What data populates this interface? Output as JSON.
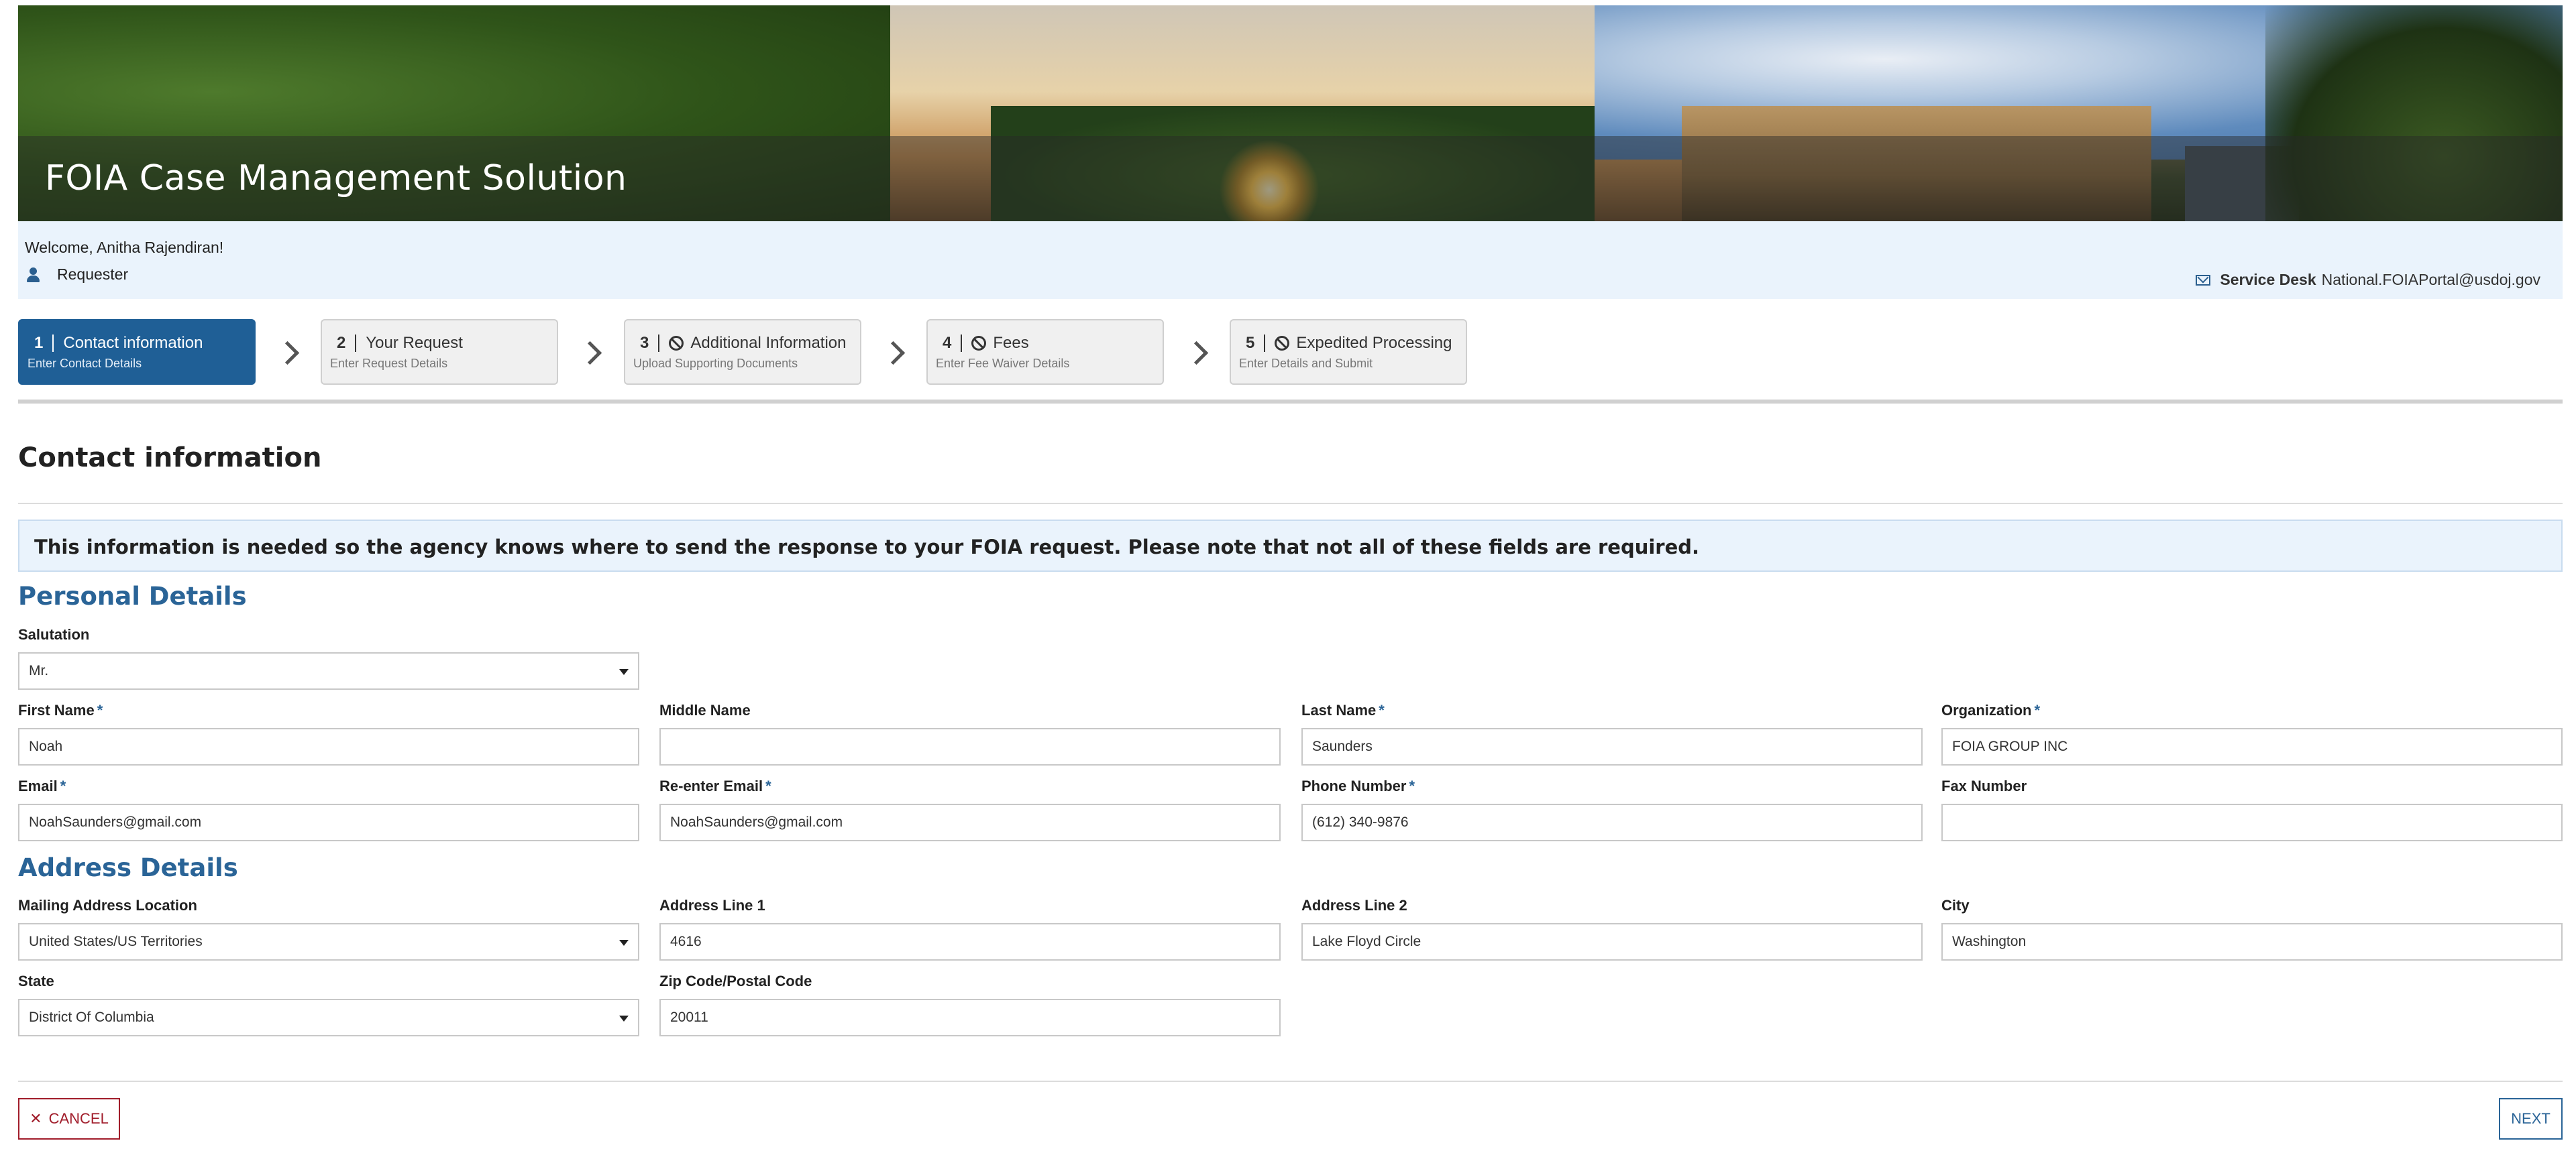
{
  "header": {
    "title": "FOIA Case Management Solution"
  },
  "welcome": {
    "greeting": "Welcome, Anitha Rajendiran!",
    "role": "Requester",
    "service_desk_label": "Service Desk",
    "service_desk_email": "National.FOIAPortal@usdoj.gov"
  },
  "steps": [
    {
      "num": "1",
      "title": "Contact information",
      "sub": "Enter Contact Details",
      "active": true
    },
    {
      "num": "2",
      "title": "Your Request",
      "sub": "Enter Request Details"
    },
    {
      "num": "3",
      "title": "Additional Information",
      "sub": "Upload Supporting Documents",
      "blocked": true
    },
    {
      "num": "4",
      "title": "Fees",
      "sub": "Enter Fee Waiver Details",
      "blocked": true
    },
    {
      "num": "5",
      "title": "Expedited Processing",
      "sub": "Enter Details and Submit",
      "blocked": true
    }
  ],
  "page_title": "Contact information",
  "notice": "This information is needed so the agency knows where to send the response to your FOIA request. Please note that not all of these fields are required.",
  "personal": {
    "heading": "Personal Details",
    "salutation_label": "Salutation",
    "salutation_value": "Mr.",
    "first_name_label": "First Name",
    "first_name_value": "Noah",
    "middle_name_label": "Middle Name",
    "middle_name_value": "",
    "last_name_label": "Last Name",
    "last_name_value": "Saunders",
    "organization_label": "Organization",
    "organization_value": "FOIA GROUP INC",
    "email_label": "Email",
    "email_value": "NoahSaunders@gmail.com",
    "reenter_email_label": "Re-enter Email",
    "reenter_email_value": "NoahSaunders@gmail.com",
    "phone_label": "Phone Number",
    "phone_value": "(612) 340-9876",
    "fax_label": "Fax Number",
    "fax_value": ""
  },
  "address": {
    "heading": "Address Details",
    "location_label": "Mailing Address Location",
    "location_value": "United States/US Territories",
    "line1_label": "Address Line 1",
    "line1_value": "4616",
    "line2_label": "Address Line 2",
    "line2_value": "Lake Floyd Circle",
    "city_label": "City",
    "city_value": "Washington",
    "state_label": "State",
    "state_value": "District Of Columbia",
    "zip_label": "Zip Code/Postal Code",
    "zip_value": "20011"
  },
  "actions": {
    "cancel": "CANCEL",
    "next": "NEXT"
  },
  "required_marker": "*"
}
